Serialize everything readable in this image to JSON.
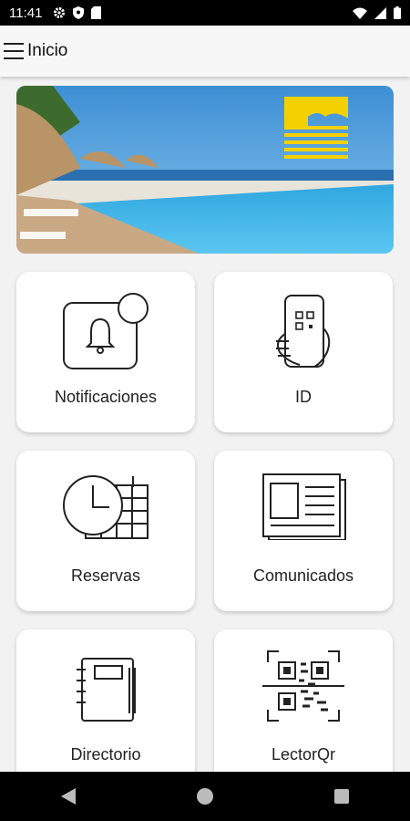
{
  "status_bar": {
    "time": "11:41"
  },
  "app_bar": {
    "title": "Inicio"
  },
  "banner": {
    "alt_icon": "resort-logo-icon"
  },
  "tiles": [
    {
      "label": "Notificaciones",
      "icon": "bell-notification-icon"
    },
    {
      "label": "ID",
      "icon": "phone-qr-hand-icon"
    },
    {
      "label": "Reservas",
      "icon": "clock-calendar-icon"
    },
    {
      "label": "Comunicados",
      "icon": "newspaper-icon"
    },
    {
      "label": "Directorio",
      "icon": "notebook-icon"
    },
    {
      "label": "LectorQr",
      "icon": "qr-scanner-icon"
    }
  ],
  "colors": {
    "logo_yellow": "#f5d000",
    "water": "#3fb1e6",
    "sky": "#4a9fd8"
  }
}
